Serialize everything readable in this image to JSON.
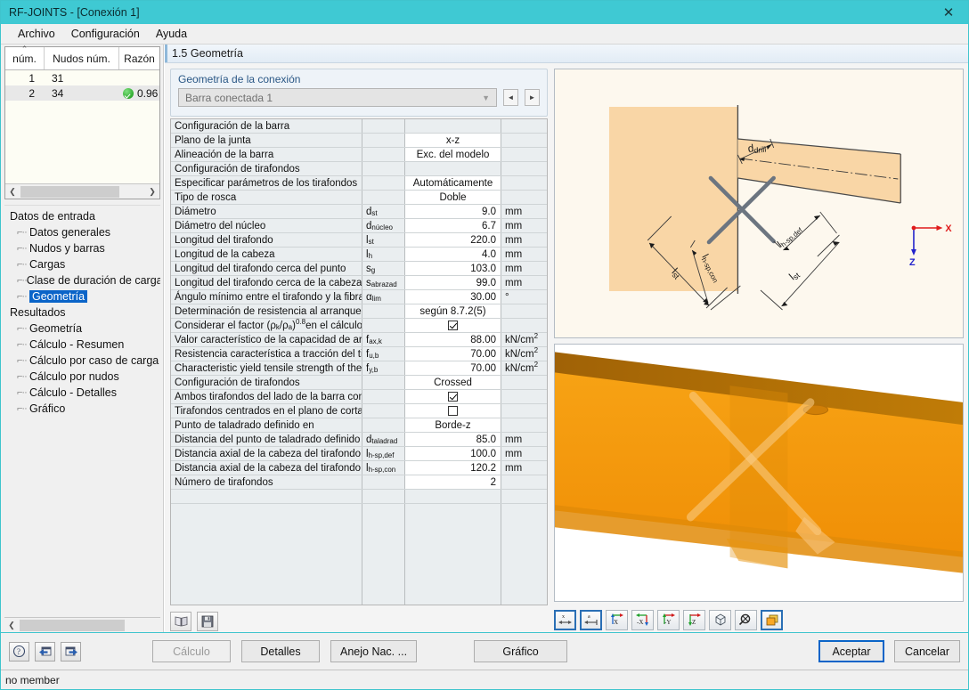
{
  "window": {
    "title": "RF-JOINTS - [Conexión 1]",
    "close_icon": "close-icon",
    "accent_color": "#3fc9d3"
  },
  "menu": {
    "items": [
      "Archivo",
      "Configuración",
      "Ayuda"
    ]
  },
  "nodes_grid": {
    "columns": [
      "núm.",
      "Nudos núm.",
      "Razón"
    ],
    "rows": [
      {
        "num": "1",
        "node": "31",
        "ratio": "",
        "status": ""
      },
      {
        "num": "2",
        "node": "34",
        "ratio": "0.96",
        "status": "ok"
      }
    ]
  },
  "tree": {
    "items": [
      {
        "label": "Datos de entrada",
        "level": 0,
        "selected": false
      },
      {
        "label": "Datos generales",
        "level": 1,
        "selected": false
      },
      {
        "label": "Nudos y barras",
        "level": 1,
        "selected": false
      },
      {
        "label": "Cargas",
        "level": 1,
        "selected": false
      },
      {
        "label": "Clase de duración de carga y se",
        "level": 1,
        "selected": false
      },
      {
        "label": "Geometría",
        "level": 1,
        "selected": true
      },
      {
        "label": "Resultados",
        "level": 0,
        "selected": false
      },
      {
        "label": "Geometría",
        "level": 1,
        "selected": false
      },
      {
        "label": "Cálculo - Resumen",
        "level": 1,
        "selected": false
      },
      {
        "label": "Cálculo por caso de carga",
        "level": 1,
        "selected": false
      },
      {
        "label": "Cálculo por nudos",
        "level": 1,
        "selected": false
      },
      {
        "label": "Cálculo - Detalles",
        "level": 1,
        "selected": false
      },
      {
        "label": "Gráfico",
        "level": 1,
        "selected": false
      }
    ]
  },
  "page": {
    "header": "1.5 Geometría"
  },
  "group": {
    "title": "Geometría de la conexión",
    "combo_value": "Barra conectada 1",
    "prev_label": "◄",
    "next_label": "►"
  },
  "properties": {
    "rows": [
      {
        "desc": "Configuración de la barra",
        "sym": "",
        "val": "",
        "unit": "",
        "kind": "section"
      },
      {
        "desc": "Plano de la junta",
        "sym": "",
        "val": "x-z",
        "unit": "",
        "kind": "value"
      },
      {
        "desc": "Alineación de la barra",
        "sym": "",
        "val": "Exc. del modelo",
        "unit": "",
        "kind": "value"
      },
      {
        "desc": "Configuración de tirafondos",
        "sym": "",
        "val": "",
        "unit": "",
        "kind": "section"
      },
      {
        "desc": "Especificar parámetros de los tirafondos",
        "sym": "",
        "val": "Automáticamente",
        "unit": "",
        "kind": "value"
      },
      {
        "desc": "Tipo de rosca",
        "sym": "",
        "val": "Doble",
        "unit": "",
        "kind": "value"
      },
      {
        "desc": "Diámetro",
        "sym": "d|st",
        "val": "9.0",
        "unit": "mm",
        "kind": "value"
      },
      {
        "desc": "Diámetro del núcleo",
        "sym": "d|núcleo",
        "val": "6.7",
        "unit": "mm",
        "kind": "value"
      },
      {
        "desc": "Longitud del tirafondo",
        "sym": "l|st",
        "val": "220.0",
        "unit": "mm",
        "kind": "value"
      },
      {
        "desc": "Longitud de la cabeza",
        "sym": "l|h",
        "val": "4.0",
        "unit": "mm",
        "kind": "value"
      },
      {
        "desc": "Longitud del tirafondo cerca del punto",
        "sym": "s|g",
        "val": "103.0",
        "unit": "mm",
        "kind": "value"
      },
      {
        "desc": "Longitud del tirafondo cerca de la cabeza",
        "sym": "s|abrazad",
        "val": "99.0",
        "unit": "mm",
        "kind": "value"
      },
      {
        "desc": "Ángulo mínimo entre el tirafondo y la fibra",
        "sym": "α|lim",
        "val": "30.00",
        "unit": "°",
        "kind": "value"
      },
      {
        "desc": "Determinación de resistencia al arranque",
        "sym": "",
        "val": "según 8.7.2(5)",
        "unit": "",
        "kind": "value"
      },
      {
        "desc": "Considerar el factor (ρk/ρa)0.8 en el cálculo",
        "sym": "",
        "val": "checked",
        "unit": "",
        "kind": "check"
      },
      {
        "desc": "Valor característico de la capacidad de arra",
        "sym": "f|ax,k",
        "val": "88.00",
        "unit": "kN/cm2",
        "kind": "value"
      },
      {
        "desc": "Resistencia característica a tracción del tira",
        "sym": "f|u,b",
        "val": "70.00",
        "unit": "kN/cm2",
        "kind": "value"
      },
      {
        "desc": "Characteristic yield tensile strength of the sc",
        "sym": "f|y,b",
        "val": "70.00",
        "unit": "kN/cm2",
        "kind": "value"
      },
      {
        "desc": "Configuración de tirafondos",
        "sym": "",
        "val": "Crossed",
        "unit": "",
        "kind": "value"
      },
      {
        "desc": "Ambos tirafondos del lado de la barra conec",
        "sym": "",
        "val": "checked",
        "unit": "",
        "kind": "check"
      },
      {
        "desc": "Tirafondos centrados en el plano de cortant",
        "sym": "",
        "val": "unchecked",
        "unit": "",
        "kind": "check"
      },
      {
        "desc": "Punto de taladrado definido en",
        "sym": "",
        "val": "Borde-z",
        "unit": "",
        "kind": "value"
      },
      {
        "desc": "Distancia del punto de taladrado definido",
        "sym": "d|taladrad",
        "val": "85.0",
        "unit": "mm",
        "kind": "value"
      },
      {
        "desc": "Distancia axial de la cabeza del tirafondo de",
        "sym": "l|h-sp,def",
        "val": "100.0",
        "unit": "mm",
        "kind": "value"
      },
      {
        "desc": "Distancia axial de la cabeza del tirafondo co",
        "sym": "l|h-sp,con",
        "val": "120.2",
        "unit": "mm",
        "kind": "value"
      },
      {
        "desc": "Número de tirafondos",
        "sym": "",
        "val": "2",
        "unit": "",
        "kind": "value"
      }
    ]
  },
  "prop_tools": {
    "buttons": [
      {
        "name": "library-button",
        "icon": "book-icon"
      },
      {
        "name": "save-button",
        "icon": "floppy-disk-icon"
      }
    ]
  },
  "diagram": {
    "labels": [
      "d drill",
      "l st",
      "l h-sp,con",
      "l h-sp,def",
      "l st"
    ],
    "axis_x": "X",
    "axis_z": "Z",
    "member_color": "#f8d4a0",
    "screw_color": "#6c7580"
  },
  "render3d": {
    "beam_color": "#f79c10",
    "top_face_color": "#b26f06",
    "background": "#ffffff"
  },
  "gfx_tools": {
    "buttons": [
      {
        "name": "dimension-x-button",
        "icon": "arrow-x-icon",
        "selected": true
      },
      {
        "name": "dimension-a-button",
        "icon": "arrow-a-icon",
        "selected": true
      },
      {
        "name": "view-x-button",
        "icon": "axis-x-icon",
        "selected": false
      },
      {
        "name": "view-minus-x-button",
        "icon": "axis-minus-x-icon",
        "selected": false
      },
      {
        "name": "view-minus-y-button",
        "icon": "axis-minus-y-icon",
        "selected": false
      },
      {
        "name": "view-z-button",
        "icon": "axis-z-icon",
        "selected": false
      },
      {
        "name": "isometric-view-button",
        "icon": "cube-icon",
        "selected": false
      },
      {
        "name": "zoom-all-button",
        "icon": "magnifier-icon",
        "selected": false
      },
      {
        "name": "layers-button",
        "icon": "layers-icon",
        "selected": true
      }
    ]
  },
  "footer": {
    "icon_buttons": [
      {
        "name": "help-button",
        "icon": "question-mark-icon"
      },
      {
        "name": "previous-dialog-button",
        "icon": "arrow-left-window-icon"
      },
      {
        "name": "next-dialog-button",
        "icon": "arrow-right-window-icon"
      }
    ],
    "calculo_label": "Cálculo",
    "detalles_label": "Detalles",
    "anejo_label": "Anejo Nac. ...",
    "grafico_label": "Gráfico",
    "accept_label": "Aceptar",
    "cancel_label": "Cancelar"
  },
  "status": {
    "text": "no member"
  }
}
